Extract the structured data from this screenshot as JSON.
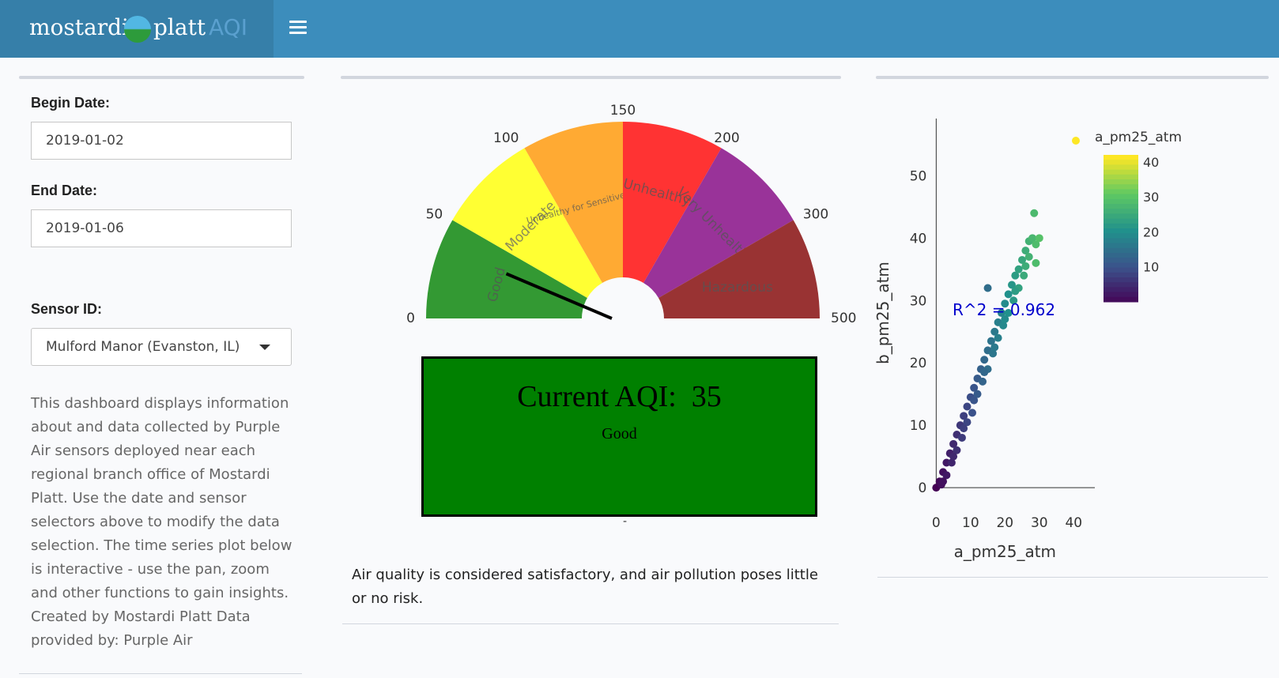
{
  "header": {
    "brand_left": "mostardi",
    "brand_right": "platt",
    "brand_suffix": "AQI",
    "globe_icon": "globe-logo-icon",
    "menu_icon": "hamburger-icon"
  },
  "sidebar": {
    "begin_label": "Begin Date:",
    "begin_value": "2019-01-02",
    "end_label": "End Date:",
    "end_value": "2019-01-06",
    "sensor_label": "Sensor ID:",
    "sensor_value": "Mulford Manor (Evanston, IL)",
    "description": "This dashboard displays information about and data collected by Purple Air sensors deployed near each regional branch office of Mostardi Platt. Use the date and sensor selectors above to modify the data selection. The time series plot below is interactive - use the pan, zoom and other functions to gain insights. Created by Mostardi Platt Data provided by: Purple Air"
  },
  "gauge": {
    "value": 35,
    "max": 500,
    "ticks": [
      "0",
      "50",
      "100",
      "150",
      "200",
      "300",
      "500"
    ],
    "bands": [
      {
        "label": "Good",
        "from": 0,
        "to": 50,
        "color": "#339933"
      },
      {
        "label": "Moderate",
        "from": 50,
        "to": 100,
        "color": "#ffff33"
      },
      {
        "label": "Unhealthy for Sensitive Groups",
        "from": 100,
        "to": 150,
        "color": "#ffaa33"
      },
      {
        "label": "Unhealthy",
        "from": 150,
        "to": 200,
        "color": "#ff3333"
      },
      {
        "label": "Very Unhealthy",
        "from": 200,
        "to": 300,
        "color": "#993399"
      },
      {
        "label": "Hazardous",
        "from": 300,
        "to": 500,
        "color": "#993333"
      }
    ]
  },
  "aqi": {
    "title": "Current AQI:  35",
    "category": "Good",
    "color": "#008000",
    "dash": "-",
    "advice": "Air quality is considered satisfactory, and air pollution poses little or no risk."
  },
  "chart_data": {
    "type": "scatter",
    "xlabel": "a_pm25_atm",
    "ylabel": "b_pm25_atm",
    "xlim": [
      -1,
      45
    ],
    "ylim": [
      -1,
      56
    ],
    "xticks": [
      "0",
      "10",
      "20",
      "30",
      "40"
    ],
    "yticks": [
      "0",
      "10",
      "20",
      "30",
      "40",
      "50"
    ],
    "annotation": "R^2 = 0.962",
    "colorbar": {
      "title": "a_pm25_atm",
      "ticks": [
        "10",
        "20",
        "30",
        "40"
      ],
      "range": [
        0,
        42
      ]
    },
    "points": [
      [
        0,
        0
      ],
      [
        1,
        1
      ],
      [
        2,
        2.5
      ],
      [
        3,
        4
      ],
      [
        4,
        5.5
      ],
      [
        5,
        7
      ],
      [
        6,
        8.5
      ],
      [
        7,
        10
      ],
      [
        8,
        11.5
      ],
      [
        9,
        13
      ],
      [
        10,
        14.5
      ],
      [
        11,
        16
      ],
      [
        12,
        17.5
      ],
      [
        13,
        19
      ],
      [
        14,
        20.5
      ],
      [
        15,
        22
      ],
      [
        16,
        23.5
      ],
      [
        17,
        25
      ],
      [
        18,
        26.5
      ],
      [
        19,
        28
      ],
      [
        20,
        29.5
      ],
      [
        21,
        31
      ],
      [
        22,
        32.5
      ],
      [
        23,
        34
      ],
      [
        24,
        35
      ],
      [
        25,
        36.5
      ],
      [
        26,
        38
      ],
      [
        27,
        39.5
      ],
      [
        28,
        40
      ],
      [
        29,
        39
      ],
      [
        30,
        40
      ],
      [
        28.5,
        44
      ],
      [
        15,
        32
      ],
      [
        3,
        2
      ],
      [
        6,
        6
      ],
      [
        9,
        10.5
      ],
      [
        12,
        15
      ],
      [
        15,
        19
      ],
      [
        18,
        24
      ],
      [
        21,
        28
      ],
      [
        24,
        32
      ],
      [
        27,
        37
      ],
      [
        29,
        36
      ],
      [
        26,
        35.5
      ],
      [
        1.5,
        0.5
      ],
      [
        4.5,
        4
      ],
      [
        7.5,
        8
      ],
      [
        10.5,
        12
      ],
      [
        13.5,
        17
      ],
      [
        16.5,
        21.5
      ],
      [
        19.5,
        26
      ],
      [
        22.5,
        30
      ],
      [
        25.5,
        34
      ],
      [
        2,
        1
      ],
      [
        5,
        5
      ],
      [
        8,
        9.5
      ],
      [
        11,
        14
      ],
      [
        14,
        18.5
      ],
      [
        17,
        22.5
      ],
      [
        20,
        27
      ],
      [
        23,
        31.5
      ]
    ]
  }
}
